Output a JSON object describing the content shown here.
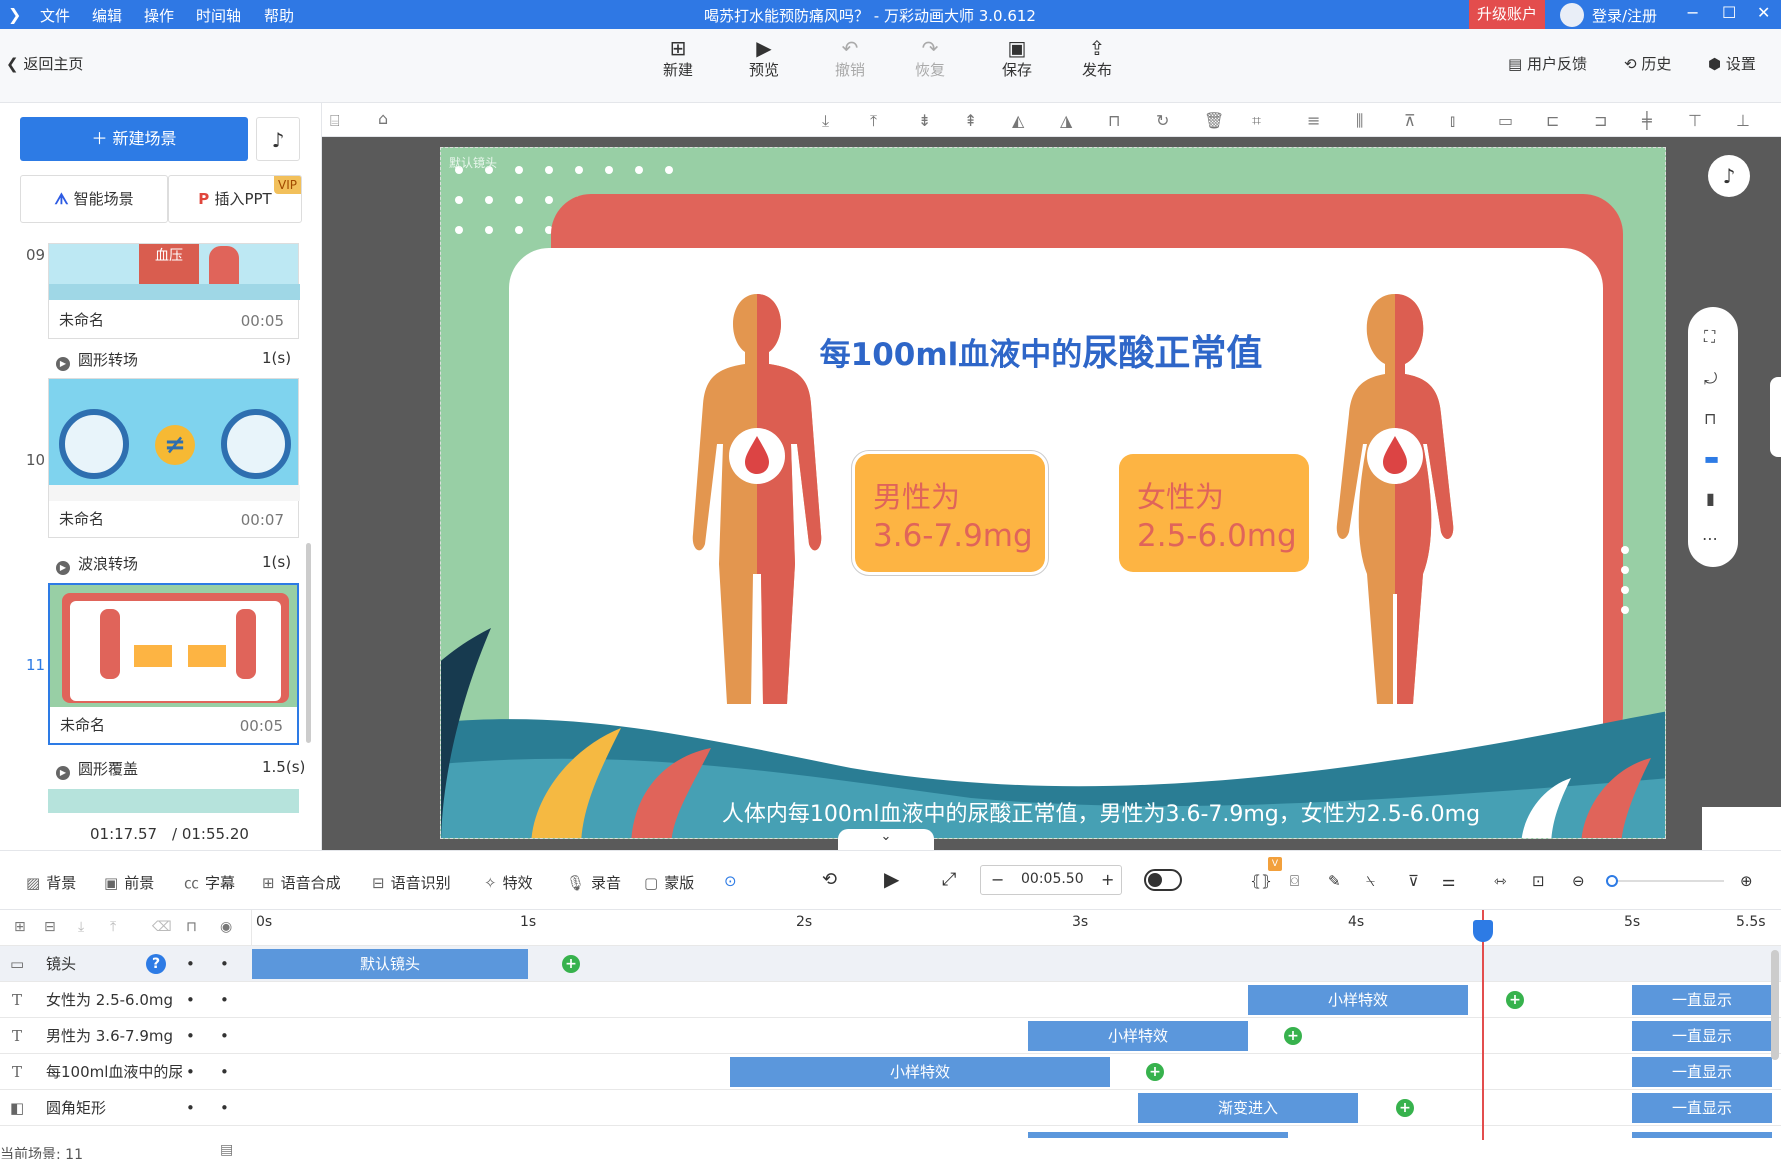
{
  "titlebar": {
    "menus": [
      "文件",
      "编辑",
      "操作",
      "时间轴",
      "帮助"
    ],
    "title": "喝苏打水能预防痛风吗？ - 万彩动画大师 3.0.612",
    "upgrade": "升级账户",
    "login": "登录/注册",
    "min": "−",
    "max": "☐",
    "close": "✕"
  },
  "toolbar": {
    "back": "返回主页",
    "new": "新建",
    "preview": "预览",
    "undo": "撤销",
    "redo": "恢复",
    "save": "保存",
    "publish": "发布",
    "feedback": "用户反馈",
    "history": "历史",
    "settings": "设置"
  },
  "left": {
    "new_scene": "新建场景",
    "smart_scene": "智能场景",
    "insert_ppt": "插入PPT",
    "vip": "VIP",
    "scenes": [
      {
        "num": "09",
        "name": "未命名",
        "time": "00:05",
        "transition": "圆形转场",
        "tdur": "1(s)"
      },
      {
        "num": "10",
        "name": "未命名",
        "time": "00:07",
        "transition": "波浪转场",
        "tdur": "1(s)"
      },
      {
        "num": "11",
        "name": "未命名",
        "time": "00:05",
        "transition": "圆形覆盖",
        "tdur": "1.5(s)"
      }
    ],
    "thumb9_text": "血压",
    "current_time": "01:17.57",
    "total_time": "/ 01:55.20"
  },
  "slide": {
    "title_a": "每100ml血液中的",
    "title_b": "尿酸正常值",
    "male_label": "男性为",
    "male_value": "3.6-7.9mg",
    "female_label": "女性为",
    "female_value": "2.5-6.0mg",
    "subtitle": "人体内每100ml血液中的尿酸正常值，男性为3.6-7.9mg，女性为2.5-6.0mg",
    "camera_label": "默认镜头"
  },
  "timeline_toolbar": {
    "bg": "背景",
    "fg": "前景",
    "subtitle": "字幕",
    "tts": "语音合成",
    "asr": "语音识别",
    "effects": "特效",
    "record": "录音",
    "mask": "蒙版",
    "time": "00:05.50"
  },
  "timeline": {
    "ticks": [
      "0s",
      "1s",
      "2s",
      "3s",
      "4s",
      "5s",
      "5.5s"
    ],
    "tracks": [
      {
        "name": "镜头",
        "bars": [
          "默认镜头"
        ]
      },
      {
        "name": "女性为 2.5-6.0mg",
        "bars": [
          "小样特效",
          "一直显示"
        ]
      },
      {
        "name": "男性为 3.6-7.9mg",
        "bars": [
          "小样特效",
          "一直显示"
        ]
      },
      {
        "name": "每100ml血液中的尿",
        "bars": [
          "小样特效",
          "一直显示"
        ]
      },
      {
        "name": "圆角矩形",
        "bars": [
          "渐变进入",
          "一直显示"
        ]
      }
    ],
    "footer": "当前场景: 11"
  },
  "colors": {
    "accent": "#2f78e4",
    "canvas_green": "#98cfa5",
    "frame_red": "#e0645a",
    "box_orange": "#fdb443",
    "title_blue": "#2e66c8",
    "bar_blue": "#5b97dc",
    "keyframe_green": "#37b24d"
  }
}
